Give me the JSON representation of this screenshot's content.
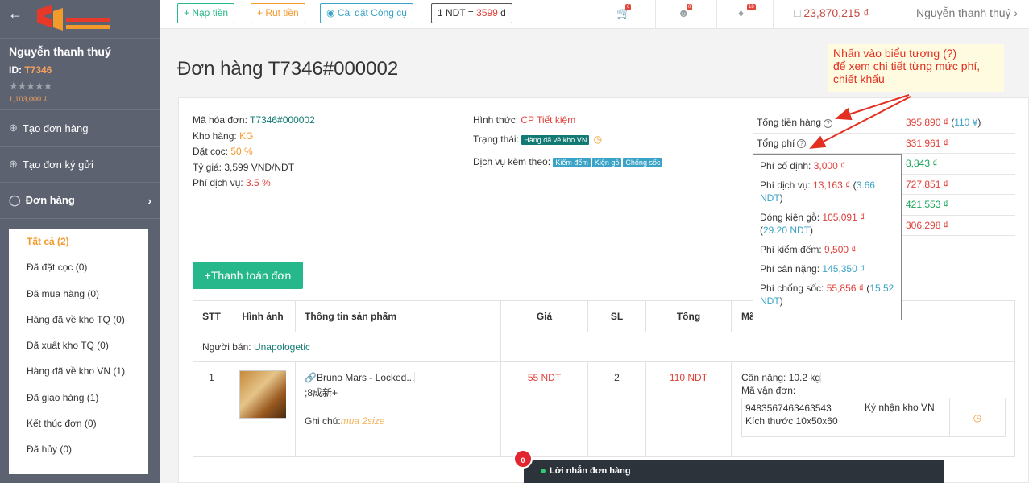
{
  "sidebar": {
    "user_name": "Nguyễn thanh thuý",
    "id_label": "ID:",
    "id_value": "T7346",
    "stars": "★★★★★",
    "balance": "1,103,000 ₫",
    "menu": [
      {
        "label": "Tạo đơn hàng"
      },
      {
        "label": "Tạo đơn ký gửi"
      },
      {
        "label": "Đơn hàng"
      }
    ],
    "submenu": [
      {
        "label": "Tất cả (2)"
      },
      {
        "label": "Đã đặt cọc (0)"
      },
      {
        "label": "Đã mua hàng (0)"
      },
      {
        "label": "Hàng đã về kho TQ (0)"
      },
      {
        "label": "Đã xuất kho TQ (0)"
      },
      {
        "label": "Hàng đã về kho VN (1)"
      },
      {
        "label": "Đã giao hàng (1)"
      },
      {
        "label": "Kết thúc đơn (0)"
      },
      {
        "label": "Đã hủy (0)"
      }
    ]
  },
  "topbar": {
    "deposit": "+ Nạp tiền",
    "withdraw": "+ Rút tiền",
    "install_tool": "Cài đặt Công cụ",
    "rate_prefix": "1 NDT = ",
    "rate_value": "3599",
    "rate_suffix": " đ",
    "cart_count": "6",
    "users_count": "0",
    "bell_count": "18",
    "balance": "23,870,215 ₫",
    "username": "Nguyễn thanh thuý"
  },
  "page": {
    "title": "Đơn hàng T7346#000002",
    "note_line1": "Nhấn vào biểu tượng (?)",
    "note_line2": "để xem chi tiết từng mức phí,",
    "note_line3": "chiết khấu"
  },
  "order": {
    "code_label": "Mã hóa đơn: ",
    "code": "T7346#000002",
    "warehouse_label": "Kho hàng: ",
    "warehouse": "KG",
    "deposit_label": "Đặt cọc: ",
    "deposit": "50 %",
    "rate_label": "Tỷ giá: ",
    "rate": "3,599 VNĐ/NDT",
    "service_label": "Phí dịch vụ: ",
    "service": "3.5 %",
    "type_label": "Hình thức: ",
    "type": "CP Tiết kiệm",
    "status_label": "Trạng thái: ",
    "status": "Hàng đã về kho VN",
    "extras_label": "Dịch vụ kèm theo: ",
    "extras": [
      "Kiểm đếm",
      "Kiện gỗ",
      "Chống sốc"
    ]
  },
  "summary": {
    "goods_label": "Tổng tiền hàng",
    "goods_value": "395,890 ₫",
    "goods_extra": "110 ¥",
    "fee_label": "Tổng phí",
    "fee_value": "331,961 ₫",
    "row3": "8,843 ₫",
    "row4": "727,851 ₫",
    "row5": "421,553 ₫",
    "row6": "306,298 ₫"
  },
  "popup": {
    "fixed_label": "Phí cố định: ",
    "fixed": "3,000 ₫",
    "service_label": "Phí dịch vụ: ",
    "service": "13,163 ₫",
    "service_ndt": "3.66 NDT",
    "wood_label": "Đóng kiện gỗ: ",
    "wood": "105,091 ₫",
    "wood_ndt": "29.20 NDT",
    "count_label": "Phí kiểm đếm: ",
    "count": "9,500 ₫",
    "weight_label": "Phí cân nặng: ",
    "weight": "145,350 ₫",
    "shock_label": "Phí chống sốc: ",
    "shock": "55,856 ₫",
    "shock_ndt": "15.52 NDT"
  },
  "pay_button": "+Thanh toán đơn",
  "table": {
    "headers": [
      "STT",
      "Hình ảnh",
      "Thông tin sản phẩm",
      "Giá",
      "SL",
      "Tổng",
      "Mã"
    ],
    "seller_label": "Người bán: ",
    "seller": "Unapologetic",
    "row": {
      "stt": "1",
      "name": "Bruno Mars - Locked...",
      "variant": ";8成新+",
      "note_label": "Ghi chú: ",
      "note": "mua 2size",
      "price": "55 NDT",
      "qty": "2",
      "total": "110 NDT",
      "weight": "Cân nặng: 10.2 kg",
      "tracking_label": "Mã vận đơn:",
      "tracking": "9483567463463543",
      "size": "Kích thước 10x50x60",
      "received": "Ký nhận kho VN"
    }
  },
  "chat": {
    "badge": "0",
    "label": "Lời nhắn đơn hàng"
  },
  "colors": {
    "accent_green": "#26b88a",
    "price_red": "#e0403a",
    "note_red": "#e22f20",
    "sidebar_bg": "#5d6270"
  }
}
